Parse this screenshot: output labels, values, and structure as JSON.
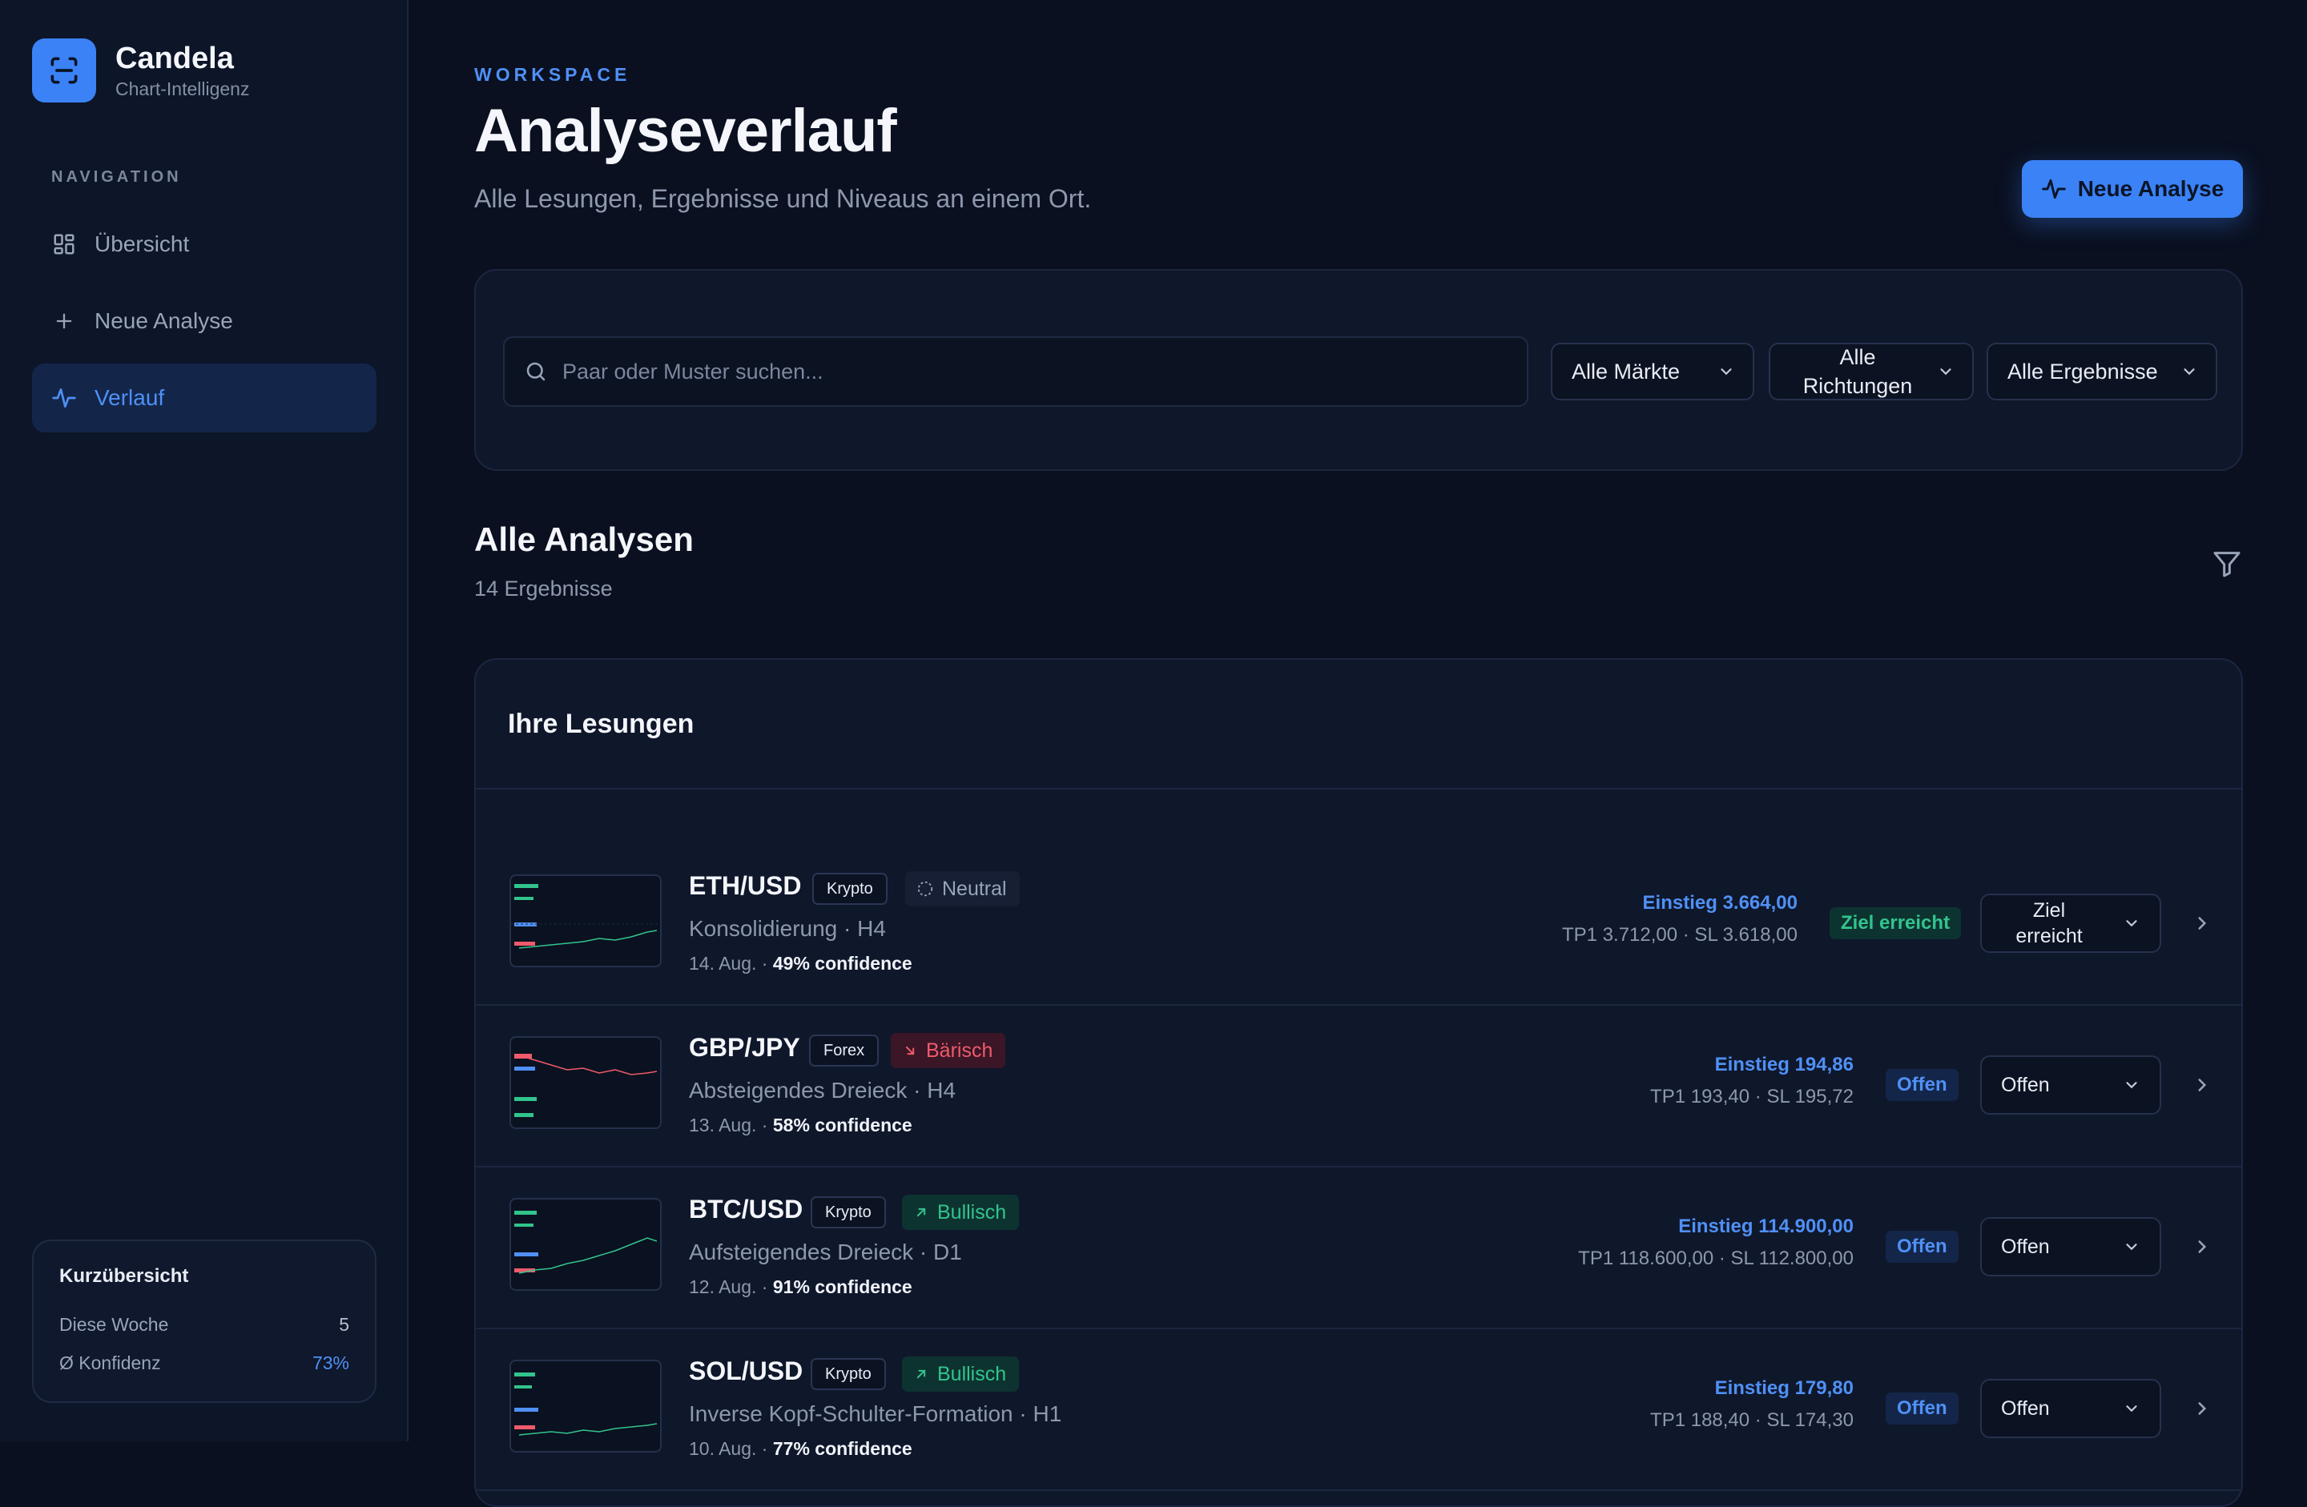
{
  "brand": {
    "name": "Candela",
    "subtitle": "Chart-Intelligenz",
    "logo_icon": "scan-icon"
  },
  "nav": {
    "heading": "NAVIGATION",
    "items": [
      {
        "label": "Übersicht",
        "icon": "dashboard-icon",
        "active": false
      },
      {
        "label": "Neue Analyse",
        "icon": "plus-icon",
        "active": false
      },
      {
        "label": "Verlauf",
        "icon": "activity-icon",
        "active": true
      }
    ]
  },
  "summary": {
    "title": "Kurzübersicht",
    "rows": [
      {
        "label": "Diese Woche",
        "value": "5"
      },
      {
        "label": "Ø Konfidenz",
        "value": "73%"
      }
    ]
  },
  "header": {
    "eyebrow": "WORKSPACE",
    "title": "Analyseverlauf",
    "subtitle": "Alle Lesungen, Ergebnisse und Niveaus an einem Ort.",
    "new_button": "Neue Analyse"
  },
  "filters": {
    "search_placeholder": "Paar oder Muster suchen...",
    "market": "Alle Märkte",
    "direction": "Alle Richtungen",
    "outcome": "Alle Ergebnisse"
  },
  "section": {
    "title": "Alle Analysen",
    "count": "14 Ergebnisse"
  },
  "list": {
    "heading": "Ihre Lesungen",
    "rows": [
      {
        "pair": "ETH/USD",
        "market": "Krypto",
        "direction": "Neutral",
        "direction_type": "neutral",
        "pattern": "Konsolidierung · H4",
        "date": "14. Aug. ·",
        "confidence": "49% confidence",
        "entry": "Einstieg 3.664,00",
        "levels": "TP1 3.712,00 · SL 3.618,00",
        "status": "Ziel erreicht",
        "outcome": "Ziel erreicht"
      },
      {
        "pair": "GBP/JPY",
        "market": "Forex",
        "direction": "Bärisch",
        "direction_type": "bear",
        "pattern": "Absteigendes Dreieck · H4",
        "date": "13. Aug. ·",
        "confidence": "58% confidence",
        "entry": "Einstieg 194,86",
        "levels": "TP1 193,40 · SL 195,72",
        "status": "Offen",
        "outcome": "Offen"
      },
      {
        "pair": "BTC/USD",
        "market": "Krypto",
        "direction": "Bullisch",
        "direction_type": "bull",
        "pattern": "Aufsteigendes Dreieck · D1",
        "date": "12. Aug. ·",
        "confidence": "91% confidence",
        "entry": "Einstieg 114.900,00",
        "levels": "TP1 118.600,00 · SL 112.800,00",
        "status": "Offen",
        "outcome": "Offen"
      },
      {
        "pair": "SOL/USD",
        "market": "Krypto",
        "direction": "Bullisch",
        "direction_type": "bull",
        "pattern": "Inverse Kopf-Schulter-Formation · H1",
        "date": "10. Aug. ·",
        "confidence": "77% confidence",
        "entry": "Einstieg 179,80",
        "levels": "TP1 188,40 · SL 174,30",
        "status": "Offen",
        "outcome": "Offen"
      }
    ]
  },
  "colors": {
    "accent": "#3b82f6",
    "bull": "#32c48d",
    "bear": "#ef5b6b",
    "background": "#0a1020"
  }
}
